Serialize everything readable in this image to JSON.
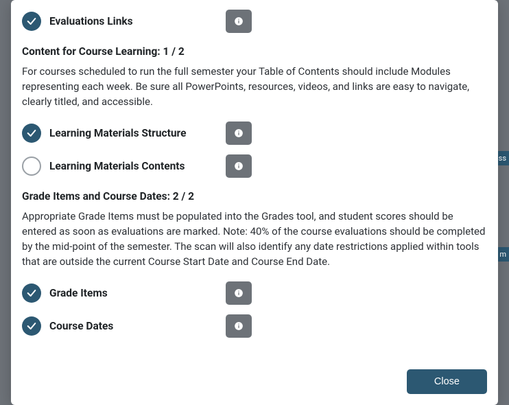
{
  "items_top": [
    {
      "label": "Evaluations Links",
      "checked": true
    }
  ],
  "section_learning": {
    "heading": "Content for Course Learning: 1 / 2",
    "description": "For courses scheduled to run the full semester your Table of Contents should include Modules representing each week. Be sure all PowerPoints, resources, videos, and links are easy to navigate, clearly titled, and accessible.",
    "items": [
      {
        "label": "Learning Materials Structure",
        "checked": true
      },
      {
        "label": "Learning Materials Contents",
        "checked": false
      }
    ]
  },
  "section_grades": {
    "heading": "Grade Items and Course Dates: 2 / 2",
    "description": "Appropriate Grade Items must be populated into the Grades tool, and student scores should be entered as soon as evaluations are marked. Note: 40% of the course evaluations should be completed by the mid-point of the semester. The scan will also identify any date restrictions applied within tools that are outside the current Course Start Date and Course End Date.",
    "items": [
      {
        "label": "Grade Items",
        "checked": true
      },
      {
        "label": "Course Dates",
        "checked": true
      }
    ]
  },
  "footer": {
    "close_label": "Close"
  }
}
